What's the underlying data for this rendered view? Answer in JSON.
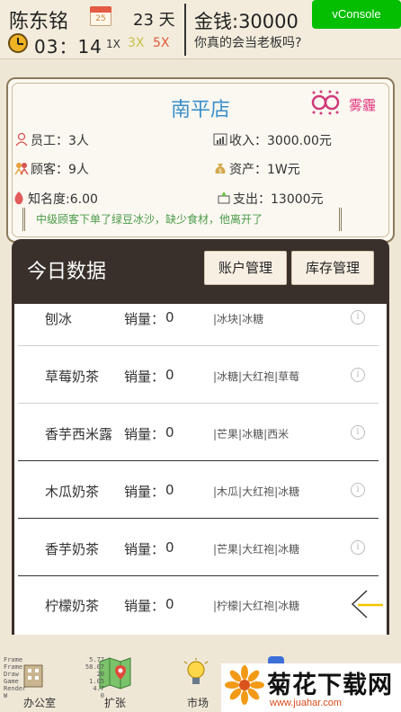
{
  "header": {
    "player_name": "陈东铭",
    "calendar_number": "25",
    "day_count": "23 天",
    "time": "03：14",
    "speed_1x": "1X",
    "speed_3x": "3X",
    "speed_5x": "5X",
    "money": "金钱:30000",
    "question": "你真的会当老板吗?",
    "vconsole_label": "vConsole"
  },
  "store": {
    "name": "南平店",
    "weather": "雾霾",
    "staff": "员工：3人",
    "revenue": "收入：3000.00元",
    "customers": "顾客：9人",
    "assets": "资产：1W元",
    "fame": "知名度:6.00",
    "expense": "支出：13000元",
    "message": "中级顾客下单了绿豆冰沙，缺少食材，他离开了"
  },
  "data_panel": {
    "title": "今日数据",
    "account_button": "账户管理",
    "stock_button": "库存管理",
    "sales_label": "销量：",
    "rows": [
      {
        "name": "刨冰",
        "sales": "0",
        "ingredients": "|冰块|冰糖"
      },
      {
        "name": "草莓奶茶",
        "sales": "0",
        "ingredients": "|冰糖|大红袍|草莓"
      },
      {
        "name": "香芋西米露",
        "sales": "0",
        "ingredients": "|芒果|冰糖|西米"
      },
      {
        "name": "木瓜奶茶",
        "sales": "0",
        "ingredients": "|木瓜|大红袍|冰糖"
      },
      {
        "name": "香芋奶茶",
        "sales": "0",
        "ingredients": "|芒果|大红袍|冰糖"
      },
      {
        "name": "柠檬奶茶",
        "sales": "0",
        "ingredients": "|柠檬|大红袍|冰糖"
      }
    ]
  },
  "bottom_nav": {
    "office": "办公室",
    "expand": "扩张",
    "market": "市场"
  },
  "watermark": {
    "title": "菊花下载网",
    "url": "www.juahar.com"
  }
}
